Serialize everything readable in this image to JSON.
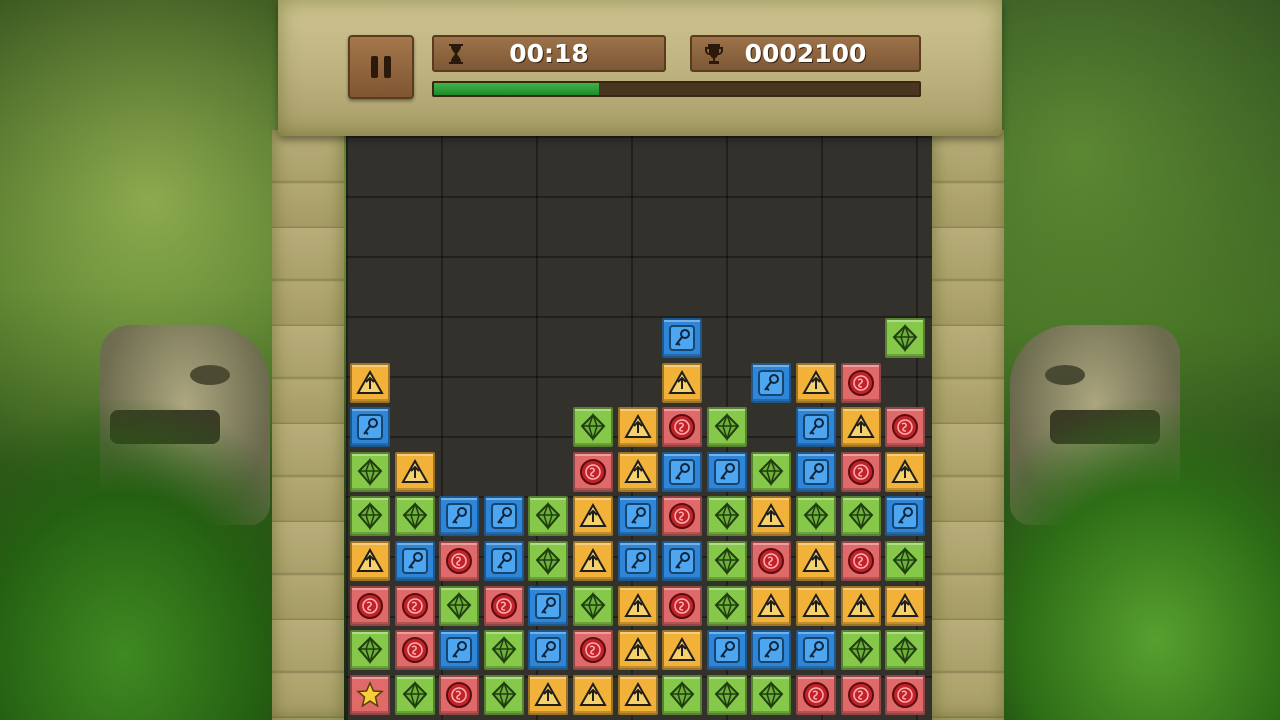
{
  "hud": {
    "timer_text": "00:18",
    "score_text": "0002100",
    "time_progress": 0.34,
    "timer_icon": "hourglass-icon",
    "score_icon": "trophy-icon",
    "pause_icon": "pause-icon"
  },
  "colors": {
    "yellow": "#f2b23a",
    "blue": "#2f86d8",
    "green": "#86c84a",
    "red": "#e06a6a",
    "progress": "#2aa33a"
  },
  "tile_types": {
    "Y": "yellow-arrow-tile",
    "B": "blue-key-tile",
    "G": "green-gem-tile",
    "R": "red-coin-tile",
    "S": "red-star-tile"
  },
  "board": {
    "columns": 13,
    "rows": 9,
    "grid": [
      [
        "",
        "",
        "",
        "",
        "",
        "",
        "",
        "B",
        "",
        "",
        "",
        "",
        "G"
      ],
      [
        "Y",
        "",
        "",
        "",
        "",
        "",
        "",
        "Y",
        "",
        "B",
        "Y",
        "R",
        ""
      ],
      [
        "B",
        "",
        "",
        "",
        "",
        "G",
        "Y",
        "R",
        "G",
        "",
        "B",
        "Y",
        "R"
      ],
      [
        "G",
        "Y",
        "",
        "",
        "",
        "R",
        "Y",
        "B",
        "B",
        "G",
        "B",
        "R",
        "Y"
      ],
      [
        "G",
        "G",
        "B",
        "B",
        "G",
        "Y",
        "B",
        "R",
        "G",
        "Y",
        "G",
        "G",
        "B"
      ],
      [
        "Y",
        "B",
        "R",
        "B",
        "G",
        "Y",
        "B",
        "B",
        "G",
        "R",
        "Y",
        "R",
        "G"
      ],
      [
        "R",
        "R",
        "G",
        "R",
        "B",
        "G",
        "Y",
        "R",
        "G",
        "Y",
        "Y",
        "Y",
        "Y"
      ],
      [
        "G",
        "R",
        "B",
        "G",
        "B",
        "R",
        "Y",
        "Y",
        "B",
        "B",
        "B",
        "G",
        "G"
      ],
      [
        "S",
        "G",
        "R",
        "G",
        "Y",
        "Y",
        "Y",
        "G",
        "G",
        "G",
        "R",
        "R",
        "R"
      ]
    ]
  }
}
